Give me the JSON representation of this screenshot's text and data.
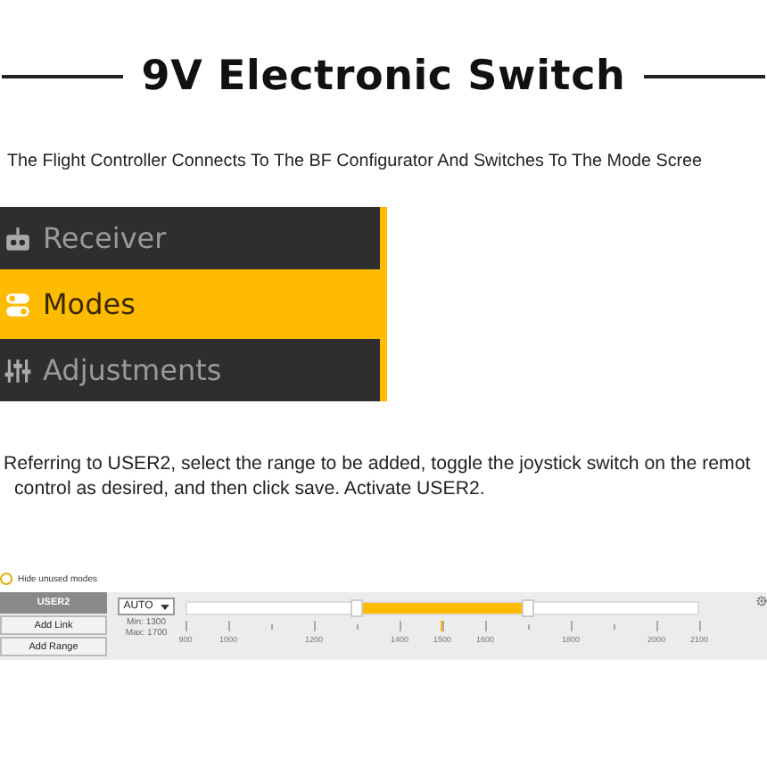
{
  "title": "9V Electronic Switch",
  "intro": "The Flight Controller Connects To The BF Configurator And Switches To The Mode Scree",
  "menu": [
    {
      "kind": "receiver",
      "label": "Receiver",
      "selected": false
    },
    {
      "kind": "modes",
      "label": "Modes",
      "selected": true
    },
    {
      "kind": "adjustments",
      "label": "Adjustments",
      "selected": false
    }
  ],
  "instructions": [
    "Referring to USER2, select the range to be added, toggle the joystick switch on the remot",
    "control as desired, and then click save. Activate USER2."
  ],
  "modes_panel": {
    "hide_unused": {
      "label": "Hide unused modes",
      "checked": false
    },
    "mode": {
      "name": "USER2",
      "buttons": [
        "Add Link",
        "Add Range"
      ]
    },
    "channel": "AUTO",
    "min": "Min: 1300",
    "max": "Max: 1700",
    "range_start": {
      "level": 0.333
    },
    "range_end": {
      "level": 0.667
    },
    "marker": {
      "level": 0.5
    },
    "ticks": [
      {
        "kind": "major",
        "label": "900"
      },
      {
        "kind": "major",
        "label": "1000"
      },
      {
        "kind": "minor"
      },
      {
        "kind": "major",
        "label": "1200"
      },
      {
        "kind": "minor"
      },
      {
        "kind": "major",
        "label": "1400"
      },
      {
        "kind": "major",
        "label": "1500"
      },
      {
        "kind": "major",
        "label": "1600"
      },
      {
        "kind": "minor"
      },
      {
        "kind": "major",
        "label": "1800"
      },
      {
        "kind": "minor"
      },
      {
        "kind": "major",
        "label": "2000"
      },
      {
        "kind": "major",
        "label": "2100"
      }
    ]
  }
}
